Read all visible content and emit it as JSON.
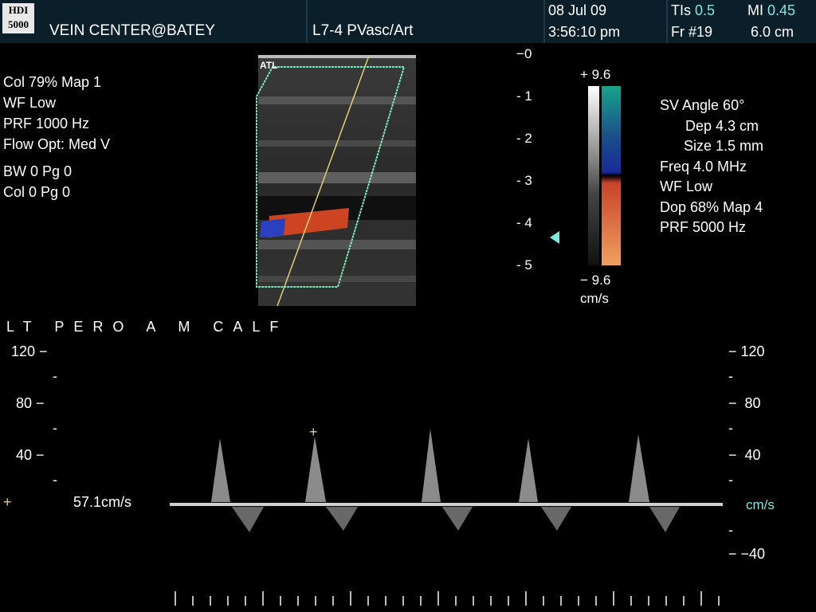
{
  "header": {
    "logo_line1": "HDI",
    "logo_line2": "5000",
    "institution": "VEIN CENTER@BATEY",
    "probe": "L7-4 PVasc/Art",
    "date": "08 Jul 09",
    "time": "3:56:10 pm",
    "tis_label": "TIs",
    "tis_value": "0.5",
    "mi_label": "MI",
    "mi_value": "0.45",
    "frame_label": "Fr",
    "frame_value": "#19",
    "depth": "6.0 cm"
  },
  "color_settings": {
    "line1": "Col 79%  Map 1",
    "line2": "WF Low",
    "line3": "PRF 1000  Hz",
    "line4": "Flow Opt: Med V",
    "line5": "BW 0    Pg 0",
    "line6": "Col 0    Pg 0"
  },
  "doppler_settings": {
    "line1": "SV Angle 60°",
    "line2": "Dep 4.3  cm",
    "line3": "Size 1.5  mm",
    "line4": "Freq 4.0  MHz",
    "line5": "WF Low",
    "line6": "Dop 68%  Map 4",
    "line7": "PRF 5000  Hz"
  },
  "image_brand": "ATL",
  "depth_scale": [
    "0",
    "1",
    "2",
    "3",
    "4",
    "5"
  ],
  "color_scale": {
    "top": "+ 9.6",
    "bottom": "− 9.6",
    "unit": "cm/s",
    "top_color": "#19a38a",
    "mid_color": "#1a2a9a",
    "low_color": "#c8442a",
    "bottom_color": "#f0a060"
  },
  "spectrum": {
    "label": "LT PERO A M CALF",
    "left_ticks": [
      "120",
      "80",
      "40"
    ],
    "right_ticks": [
      "120",
      "80",
      "40",
      "−40"
    ],
    "baseline_unit": "cm/s",
    "measurement": "57.1cm/s"
  }
}
